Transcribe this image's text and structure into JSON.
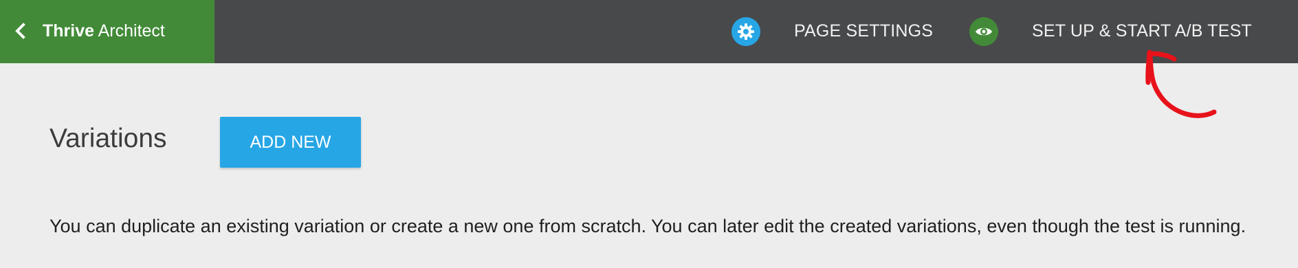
{
  "topbar": {
    "brand_bold": "Thrive",
    "brand_rest": "Architect",
    "back_icon": "chevron-left-icon",
    "page_settings_label": "PAGE SETTINGS",
    "page_settings_icon": "gear-icon",
    "ab_test_label": "SET UP & START A/B TEST",
    "ab_test_icon": "eye-icon",
    "colors": {
      "bar": "#48494b",
      "brand": "#428a38",
      "settings_icon_bg": "#27a6e6",
      "ab_icon_bg": "#428a38"
    }
  },
  "main": {
    "title": "Variations",
    "add_button_label": "ADD NEW",
    "add_button_color": "#27a6e6",
    "description": "You can duplicate an existing variation or create a new one from scratch. You can later edit the created variations, even though the test is running."
  },
  "annotation": {
    "arrow_color": "#e8121a",
    "arrow_icon": "hand-drawn-arrow-annotation"
  }
}
